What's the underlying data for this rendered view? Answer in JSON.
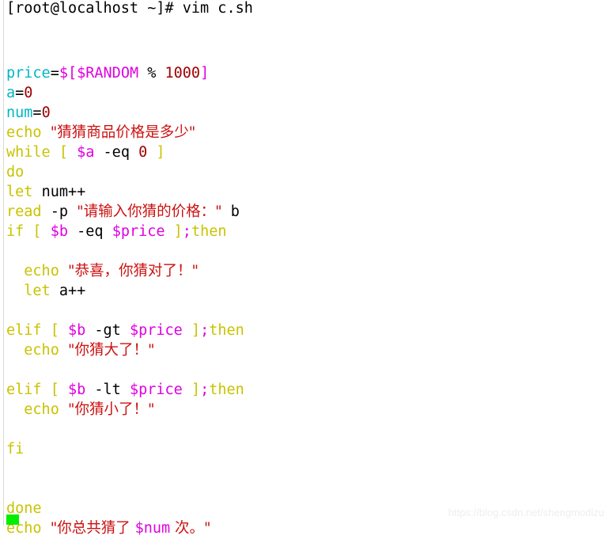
{
  "window": {
    "title": "vim c.sh",
    "background_color": "#ffffff"
  },
  "prompt": {
    "text": "[root@localhost ~]# vim c.sh",
    "user": "root",
    "host": "localhost",
    "cwd": "~",
    "symbol": "#",
    "command": "vim c.sh"
  },
  "colors": {
    "variable_cyan": "#00b7c3",
    "keyword_olive": "#c9c300",
    "dollar_magenta": "#e000e0",
    "string_red": "#cc1111",
    "number_darkred": "#a00000",
    "plain_black": "#000000",
    "cursor_green": "#00ee00",
    "watermark_gray": "#eeeeee"
  },
  "editor": {
    "filename": "c.sh",
    "cursor": {
      "line": 25,
      "column": 1,
      "shape": "block",
      "color": "#00ee00"
    },
    "lines": [
      {
        "n": 1,
        "tokens": [
          {
            "t": "price",
            "c": "tok-var"
          },
          {
            "t": "=",
            "c": "tok-op"
          },
          {
            "t": "$[$",
            "c": "tok-dollar"
          },
          {
            "t": "RANDOM",
            "c": "tok-dollar"
          },
          {
            "t": " ",
            "c": "tok-op"
          },
          {
            "t": "%",
            "c": "tok-op"
          },
          {
            "t": " ",
            "c": "tok-op"
          },
          {
            "t": "1000",
            "c": "tok-number"
          },
          {
            "t": "]",
            "c": "tok-dollar"
          }
        ]
      },
      {
        "n": 2,
        "tokens": [
          {
            "t": "a",
            "c": "tok-var"
          },
          {
            "t": "=",
            "c": "tok-op"
          },
          {
            "t": "0",
            "c": "tok-number"
          }
        ]
      },
      {
        "n": 3,
        "tokens": [
          {
            "t": "num",
            "c": "tok-var"
          },
          {
            "t": "=",
            "c": "tok-op"
          },
          {
            "t": "0",
            "c": "tok-number"
          }
        ]
      },
      {
        "n": 4,
        "tokens": [
          {
            "t": "echo",
            "c": "tok-builtin"
          },
          {
            "t": " ",
            "c": "tok-op"
          },
          {
            "t": "\"猜猜商品价格是多少\"",
            "c": "tok-string cjk"
          }
        ]
      },
      {
        "n": 5,
        "tokens": [
          {
            "t": "while",
            "c": "tok-keyword"
          },
          {
            "t": " ",
            "c": "tok-op"
          },
          {
            "t": "[",
            "c": "tok-delim"
          },
          {
            "t": " ",
            "c": "tok-op"
          },
          {
            "t": "$a",
            "c": "tok-dollar"
          },
          {
            "t": " -eq ",
            "c": "tok-op"
          },
          {
            "t": "0",
            "c": "tok-number"
          },
          {
            "t": " ",
            "c": "tok-op"
          },
          {
            "t": "]",
            "c": "tok-delim"
          }
        ]
      },
      {
        "n": 6,
        "tokens": [
          {
            "t": "do",
            "c": "tok-keyword"
          }
        ]
      },
      {
        "n": 7,
        "tokens": [
          {
            "t": "let",
            "c": "tok-builtin"
          },
          {
            "t": " ",
            "c": "tok-op"
          },
          {
            "t": "num++",
            "c": "tok-ident"
          }
        ]
      },
      {
        "n": 8,
        "tokens": [
          {
            "t": "read",
            "c": "tok-builtin"
          },
          {
            "t": " -p ",
            "c": "tok-op"
          },
          {
            "t": "\"请输入你猜的价格：\"",
            "c": "tok-string cjk"
          },
          {
            "t": " b",
            "c": "tok-ident"
          }
        ]
      },
      {
        "n": 9,
        "tokens": [
          {
            "t": "if",
            "c": "tok-keyword"
          },
          {
            "t": " ",
            "c": "tok-op"
          },
          {
            "t": "[",
            "c": "tok-delim"
          },
          {
            "t": " ",
            "c": "tok-op"
          },
          {
            "t": "$b",
            "c": "tok-dollar"
          },
          {
            "t": " -eq ",
            "c": "tok-op"
          },
          {
            "t": "$price",
            "c": "tok-dollar"
          },
          {
            "t": " ",
            "c": "tok-op"
          },
          {
            "t": "]",
            "c": "tok-delim"
          },
          {
            "t": ";",
            "c": "tok-dollar"
          },
          {
            "t": "then",
            "c": "tok-keyword"
          }
        ]
      },
      {
        "n": 10,
        "tokens": []
      },
      {
        "n": 11,
        "tokens": [
          {
            "t": "  ",
            "c": "tok-op"
          },
          {
            "t": "echo",
            "c": "tok-builtin"
          },
          {
            "t": " ",
            "c": "tok-op"
          },
          {
            "t": "\"恭喜，你猜对了！\"",
            "c": "tok-string cjk"
          }
        ]
      },
      {
        "n": 12,
        "tokens": [
          {
            "t": "  ",
            "c": "tok-op"
          },
          {
            "t": "let",
            "c": "tok-builtin"
          },
          {
            "t": " ",
            "c": "tok-op"
          },
          {
            "t": "a++",
            "c": "tok-ident"
          }
        ]
      },
      {
        "n": 13,
        "tokens": []
      },
      {
        "n": 14,
        "tokens": [
          {
            "t": "elif",
            "c": "tok-keyword"
          },
          {
            "t": " ",
            "c": "tok-op"
          },
          {
            "t": "[",
            "c": "tok-delim"
          },
          {
            "t": " ",
            "c": "tok-op"
          },
          {
            "t": "$b",
            "c": "tok-dollar"
          },
          {
            "t": " -gt ",
            "c": "tok-op"
          },
          {
            "t": "$price",
            "c": "tok-dollar"
          },
          {
            "t": " ",
            "c": "tok-op"
          },
          {
            "t": "]",
            "c": "tok-delim"
          },
          {
            "t": ";",
            "c": "tok-dollar"
          },
          {
            "t": "then",
            "c": "tok-keyword"
          }
        ]
      },
      {
        "n": 15,
        "tokens": [
          {
            "t": "  ",
            "c": "tok-op"
          },
          {
            "t": "echo",
            "c": "tok-builtin"
          },
          {
            "t": " ",
            "c": "tok-op"
          },
          {
            "t": "\"你猜大了！\"",
            "c": "tok-string cjk"
          }
        ]
      },
      {
        "n": 16,
        "tokens": []
      },
      {
        "n": 17,
        "tokens": [
          {
            "t": "elif",
            "c": "tok-keyword"
          },
          {
            "t": " ",
            "c": "tok-op"
          },
          {
            "t": "[",
            "c": "tok-delim"
          },
          {
            "t": " ",
            "c": "tok-op"
          },
          {
            "t": "$b",
            "c": "tok-dollar"
          },
          {
            "t": " -lt ",
            "c": "tok-op"
          },
          {
            "t": "$price",
            "c": "tok-dollar"
          },
          {
            "t": " ",
            "c": "tok-op"
          },
          {
            "t": "]",
            "c": "tok-delim"
          },
          {
            "t": ";",
            "c": "tok-dollar"
          },
          {
            "t": "then",
            "c": "tok-keyword"
          }
        ]
      },
      {
        "n": 18,
        "tokens": [
          {
            "t": "  ",
            "c": "tok-op"
          },
          {
            "t": "echo",
            "c": "tok-builtin"
          },
          {
            "t": " ",
            "c": "tok-op"
          },
          {
            "t": "\"你猜小了！\"",
            "c": "tok-string cjk"
          }
        ]
      },
      {
        "n": 19,
        "tokens": []
      },
      {
        "n": 20,
        "tokens": [
          {
            "t": "fi",
            "c": "tok-keyword"
          }
        ]
      },
      {
        "n": 21,
        "tokens": []
      },
      {
        "n": 22,
        "tokens": []
      },
      {
        "n": 23,
        "tokens": [
          {
            "t": "done",
            "c": "tok-keyword"
          }
        ]
      },
      {
        "n": 24,
        "tokens": [
          {
            "t": "echo",
            "c": "tok-builtin"
          },
          {
            "t": " ",
            "c": "tok-op"
          },
          {
            "t": "\"你总共猜了 ",
            "c": "tok-string cjk"
          },
          {
            "t": "$num",
            "c": "tok-dollar"
          },
          {
            "t": " 次。\"",
            "c": "tok-string cjk"
          }
        ]
      },
      {
        "n": 25,
        "tokens": []
      }
    ]
  },
  "watermark": {
    "text": "https://blog.csdn.net/shengmodizu"
  }
}
